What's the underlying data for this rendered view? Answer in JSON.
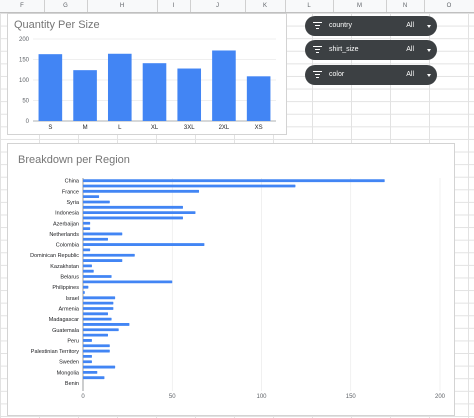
{
  "columns": [
    "F",
    "G",
    "H",
    "I",
    "J",
    "K",
    "L",
    "M",
    "N",
    "O"
  ],
  "filters": [
    {
      "label": "country",
      "value": "All"
    },
    {
      "label": "shirt_size",
      "value": "All"
    },
    {
      "label": "color",
      "value": "All"
    }
  ],
  "chart_data": [
    {
      "type": "bar",
      "title": "Quantity Per Size",
      "categories": [
        "S",
        "M",
        "L",
        "XL",
        "3XL",
        "2XL",
        "XS"
      ],
      "values": [
        163,
        124,
        164,
        141,
        128,
        172,
        109
      ],
      "ylim": [
        0,
        200
      ],
      "yticks": [
        "0",
        "50",
        "100",
        "150",
        "200"
      ],
      "color": "#4285f4"
    },
    {
      "type": "bar",
      "orientation": "horizontal",
      "title": "Breakdown per Region",
      "categories": [
        "China",
        "",
        "France",
        "",
        "Syria",
        "",
        "Indonesia",
        "",
        "Azerbaijan",
        "",
        "Netherlands",
        "",
        "Colombia",
        "",
        "Dominican Republic",
        "",
        "Kazakhstan",
        "",
        "Belarus",
        "",
        "Philippines",
        "",
        "Israel",
        "",
        "Armenia",
        "",
        "Madagascar",
        "",
        "Guatemala",
        "",
        "Peru",
        "",
        "Palestinian Territory",
        "",
        "Sweden",
        "",
        "Mongolia",
        "",
        "Benin",
        ""
      ],
      "values": [
        169,
        119,
        65,
        9,
        15,
        56,
        63,
        56,
        4,
        4,
        22,
        14,
        68,
        4,
        29,
        22,
        5,
        6,
        16,
        50,
        3,
        1,
        18,
        17,
        17,
        14,
        16,
        26,
        20,
        14,
        5,
        15,
        15,
        5,
        5,
        18,
        8,
        12,
        0,
        0
      ],
      "xlim": [
        0,
        200
      ],
      "xticks": [
        "0",
        "50",
        "100",
        "150",
        "200"
      ],
      "color": "#4285f4"
    }
  ]
}
